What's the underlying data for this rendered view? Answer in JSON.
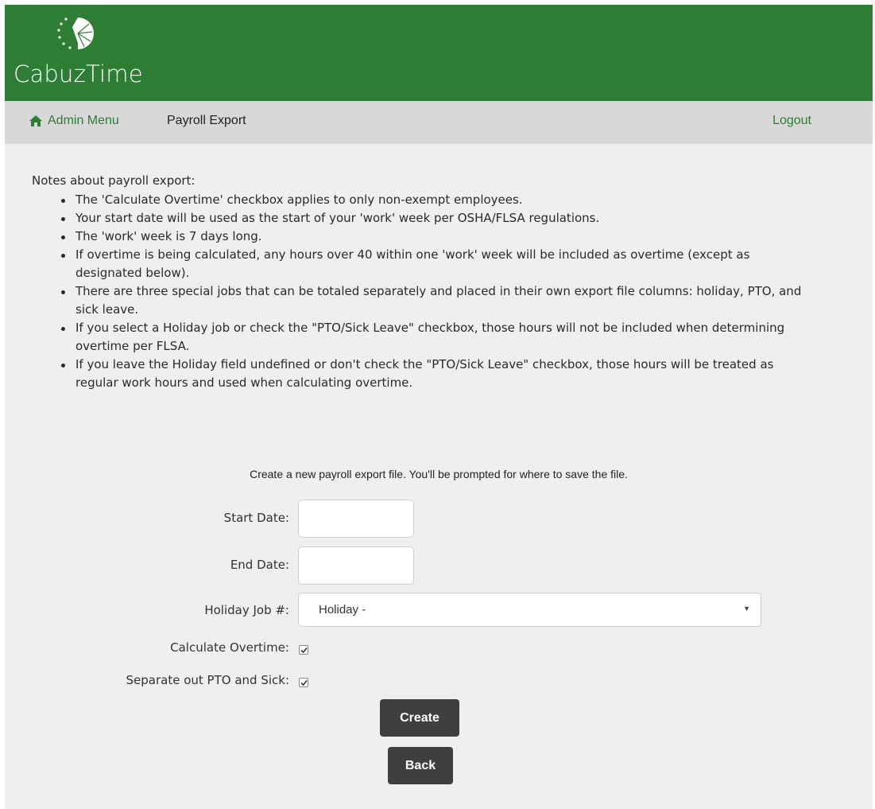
{
  "brand": {
    "name": "CabuzTime",
    "colors": {
      "header": "#2e7d35",
      "navbar": "#d8d8d8",
      "button": "#3f3f3f"
    }
  },
  "nav": {
    "home_label": "Admin Menu",
    "home_icon": "home-icon",
    "current_page": "Payroll Export",
    "logout_label": "Logout"
  },
  "notes": {
    "title": "Notes about payroll export:",
    "items": [
      "The 'Calculate Overtime' checkbox applies to only non-exempt employees.",
      "Your start date will be used as the start of your 'work' week per OSHA/FLSA regulations.",
      "The 'work' week is 7 days long.",
      "If overtime is being calculated, any hours over 40 within one 'work' week will be included as overtime (except as designated below).",
      "There are three special jobs that can be totaled separately and placed in their own export file columns: holiday, PTO, and sick leave.",
      "If you select a Holiday job or check the \"PTO/Sick Leave\" checkbox, those hours will not be included when determining overtime per FLSA.",
      "If you leave the Holiday field undefined or don't check the \"PTO/Sick Leave\" checkbox, those hours will be treated as regular work hours and used when calculating overtime."
    ]
  },
  "form": {
    "intro": "Create a new payroll export file. You'll be prompted for where to save the file.",
    "start_date_label": "Start Date:",
    "start_date_value": "",
    "end_date_label": "End Date:",
    "end_date_value": "",
    "holiday_label": "Holiday Job #:",
    "holiday_selected": "Holiday -",
    "overtime_label": "Calculate Overtime:",
    "overtime_checked": true,
    "pto_label": "Separate out PTO and Sick:",
    "pto_checked": true,
    "create_label": "Create",
    "back_label": "Back"
  }
}
